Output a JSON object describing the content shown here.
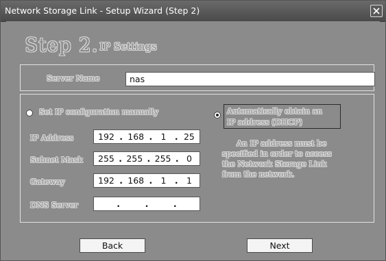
{
  "window": {
    "title": "Network Storage Link - Setup Wizard (Step 2)"
  },
  "header": {
    "step": "Step 2.",
    "subtitle": "IP Settings"
  },
  "server": {
    "label": "Server Name",
    "value": "nas"
  },
  "manual": {
    "label": "Set IP configuration manually",
    "selected": false
  },
  "dhcp": {
    "line1": "Automatically obtain an",
    "line2": "IP address (DHCP)",
    "selected": true
  },
  "fields": {
    "ip": {
      "label": "IP Address",
      "octets": [
        "192",
        "168",
        "1",
        "25"
      ]
    },
    "subnet": {
      "label": "Subnet Mask",
      "octets": [
        "255",
        "255",
        "255",
        "0"
      ]
    },
    "gateway": {
      "label": "Gateway",
      "octets": [
        "192",
        "168",
        "1",
        "1"
      ]
    },
    "dns": {
      "label": "DNS Server",
      "octets": [
        "",
        "",
        "",
        ""
      ]
    }
  },
  "help": {
    "line1": "An IP address must be",
    "line2": "specified in order to access",
    "line3": "the Network Storage Link",
    "line4": "from the network."
  },
  "buttons": {
    "back": "Back",
    "next": "Next"
  },
  "icons": {
    "close": "close-icon"
  }
}
